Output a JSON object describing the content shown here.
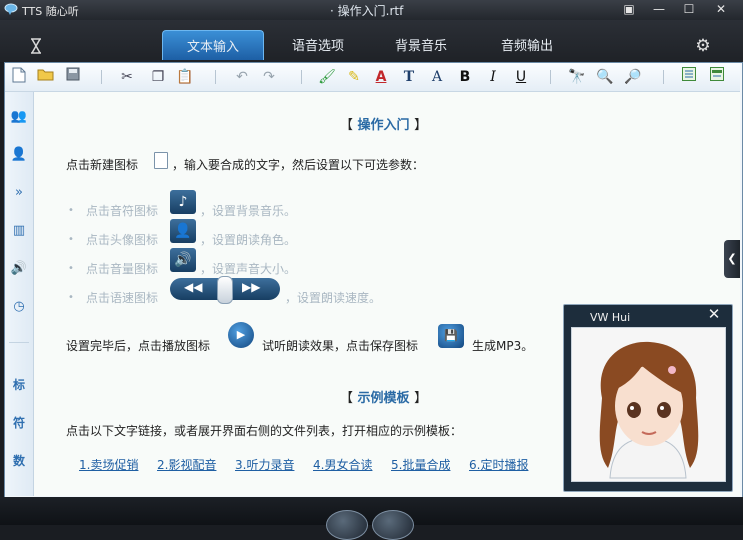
{
  "titlebar": {
    "app_title": "TTS 随心听",
    "document_title": "· 操作入门.rtf",
    "menu_icon": "dropdown-menu-icon",
    "minimize_icon": "minimize-icon",
    "maximize_icon": "maximize-icon",
    "close_icon": "close-icon"
  },
  "tabs": [
    {
      "label": "文本输入",
      "active": true
    },
    {
      "label": "语音选项",
      "active": false
    },
    {
      "label": "背景音乐",
      "active": false
    },
    {
      "label": "音频输出",
      "active": false
    }
  ],
  "toolbar": {
    "icons": [
      "new-file-icon",
      "open-folder-icon",
      "save-icon",
      "cut-icon",
      "copy-icon",
      "paste-icon",
      "undo-icon",
      "redo-icon",
      "highlight-color-icon",
      "font-color-icon",
      "font-size-icon",
      "font-icon",
      "bold-icon",
      "italic-icon",
      "underline-icon",
      "find-icon",
      "zoom-in-icon",
      "zoom-out-icon",
      "list-view-icon",
      "detail-view-icon"
    ],
    "font_color_glyph": "A",
    "text_glyph": "T",
    "bold_glyph": "B",
    "italic_glyph": "I",
    "underline_glyph": "U"
  },
  "sidebar": {
    "items": [
      "role-group-icon",
      "user-icon",
      "forward-icon",
      "equalizer-icon",
      "volume-icon",
      "clock-icon"
    ],
    "text_items": [
      "标",
      "符",
      "数"
    ]
  },
  "content": {
    "section1_title": "操作入门",
    "bracket_left": "【",
    "bracket_right": "】",
    "intro_pre": "点击新建图标",
    "intro_post": "，输入要合成的文字，然后设置以下可选参数：",
    "opt1_pre": "点击音符图标",
    "opt1_post": "，设置背景音乐。",
    "opt2_pre": "点击头像图标",
    "opt2_post": "，设置朗读角色。",
    "opt3_pre": "点击音量图标",
    "opt3_post": "，设置声音大小。",
    "opt4_pre": "点击语速图标",
    "opt4_post": "，设置朗读速度。",
    "done_pre": "设置完毕后，点击播放图标",
    "done_mid": "试听朗读效果，点击保存图标",
    "done_post": "生成MP3。",
    "section2_title": "示例模板",
    "tpl_intro": "点击以下文字链接，或者展开界面右侧的文件列表，打开相应的示例模板：",
    "templates": [
      "1.卖场促销",
      "2.影视配音",
      "3.听力录音",
      "4.男女合读",
      "5.批量合成",
      "6.定时播报"
    ]
  },
  "voice_panel": {
    "title": "VW Hui",
    "close_glyph": "✕"
  }
}
